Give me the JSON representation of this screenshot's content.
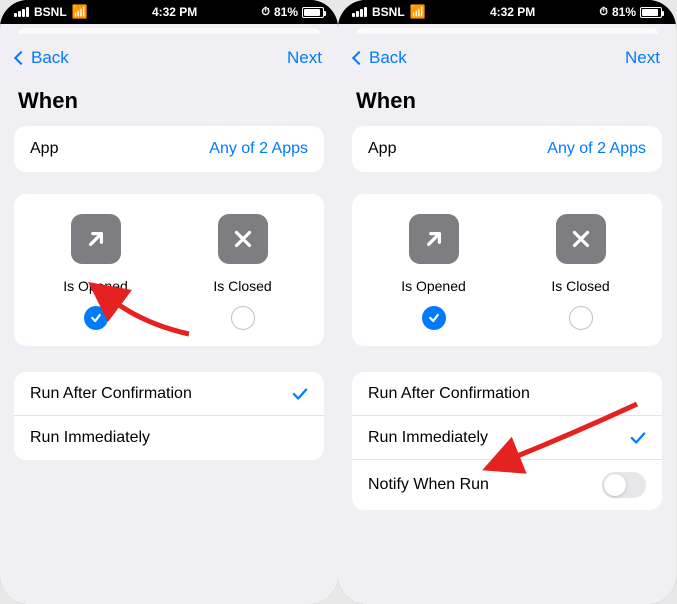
{
  "statusbar": {
    "carrier": "BSNL",
    "time": "4:32 PM",
    "battery_pct": "81%"
  },
  "nav": {
    "back": "Back",
    "next": "Next"
  },
  "title": "When",
  "app_row": {
    "label": "App",
    "value": "Any of 2 Apps"
  },
  "states": {
    "opened": "Is Opened",
    "closed": "Is Closed"
  },
  "left": {
    "run_confirm": "Run After Confirmation",
    "run_immediate": "Run Immediately",
    "selected": "confirm"
  },
  "right": {
    "run_confirm": "Run After Confirmation",
    "run_immediate": "Run Immediately",
    "notify": "Notify When Run",
    "selected": "immediate"
  }
}
